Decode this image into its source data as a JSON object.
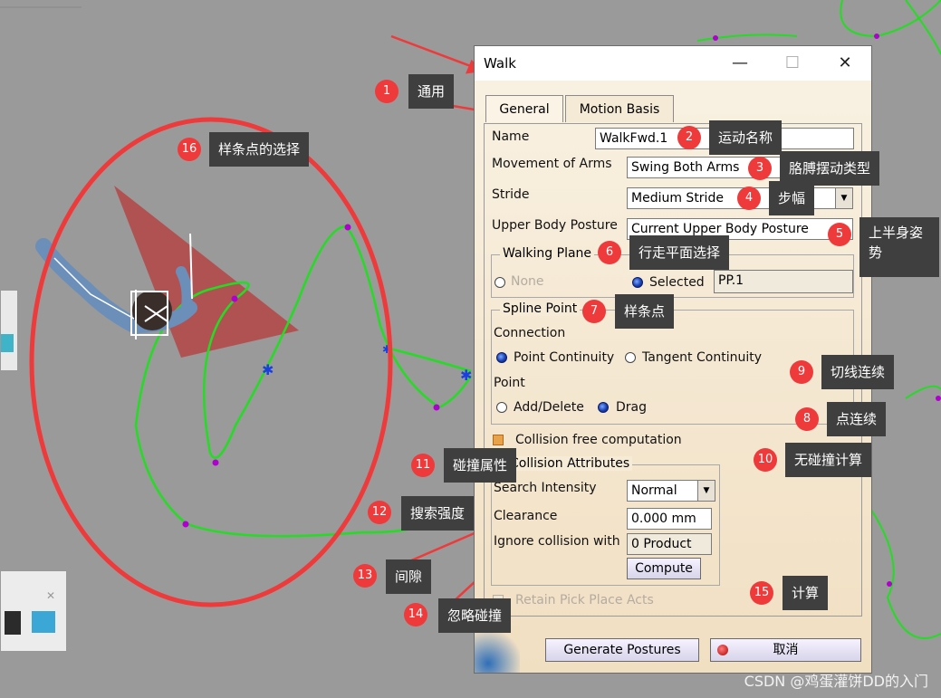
{
  "dialog": {
    "title": "Walk",
    "tabs": [
      {
        "label": "General"
      },
      {
        "label": "Motion Basis"
      }
    ],
    "name_label": "Name",
    "name_value": "WalkFwd.1",
    "arms_label": "Movement of Arms",
    "arms_value": "Swing Both Arms",
    "stride_label": "Stride",
    "stride_value": "Medium Stride",
    "upper_label": "Upper Body Posture",
    "upper_value": "Current Upper Body Posture",
    "walking_plane": {
      "title": "Walking Plane",
      "none": "None",
      "selected": "Selected",
      "value": "PP.1"
    },
    "spline_point": {
      "title": "Spline Point",
      "connection": "Connection",
      "point_continuity": "Point Continuity",
      "tangent_continuity": "Tangent Continuity",
      "point": "Point",
      "add_delete": "Add/Delete",
      "drag": "Drag"
    },
    "collision_free": "Collision free computation",
    "collision_attributes": {
      "title": "Collision Attributes",
      "search_label": "Search Intensity",
      "search_value": "Normal",
      "clearance_label": "Clearance",
      "clearance_value": "0.000 mm",
      "ignore_label": "Ignore collision with",
      "ignore_value": "0 Product",
      "compute": "Compute"
    },
    "retain": "Retain Pick Place Acts",
    "generate": "Generate Postures",
    "cancel": "取消"
  },
  "annotations": [
    {
      "n": "1",
      "text": "通用"
    },
    {
      "n": "2",
      "text": "运动名称"
    },
    {
      "n": "3",
      "text": "胳膊摆动类型"
    },
    {
      "n": "4",
      "text": "步幅"
    },
    {
      "n": "5",
      "text": "上半身姿势"
    },
    {
      "n": "6",
      "text": "行走平面选择"
    },
    {
      "n": "7",
      "text": "样条点"
    },
    {
      "n": "8",
      "text": "点连续"
    },
    {
      "n": "9",
      "text": "切线连续"
    },
    {
      "n": "10",
      "text": "无碰撞计算"
    },
    {
      "n": "11",
      "text": "碰撞属性"
    },
    {
      "n": "12",
      "text": "搜索强度"
    },
    {
      "n": "13",
      "text": "间隙"
    },
    {
      "n": "14",
      "text": "忽略碰撞"
    },
    {
      "n": "15",
      "text": "计算"
    },
    {
      "n": "16",
      "text": "样条点的选择"
    }
  ],
  "watermark": "CSDN @鸡蛋灌饼DD的入门",
  "colors": {
    "annotation_red": "#ee3a3a",
    "tag_bg": "#3f3f3f",
    "spline": "#22dd22",
    "viewport": "#9a9a9a"
  }
}
